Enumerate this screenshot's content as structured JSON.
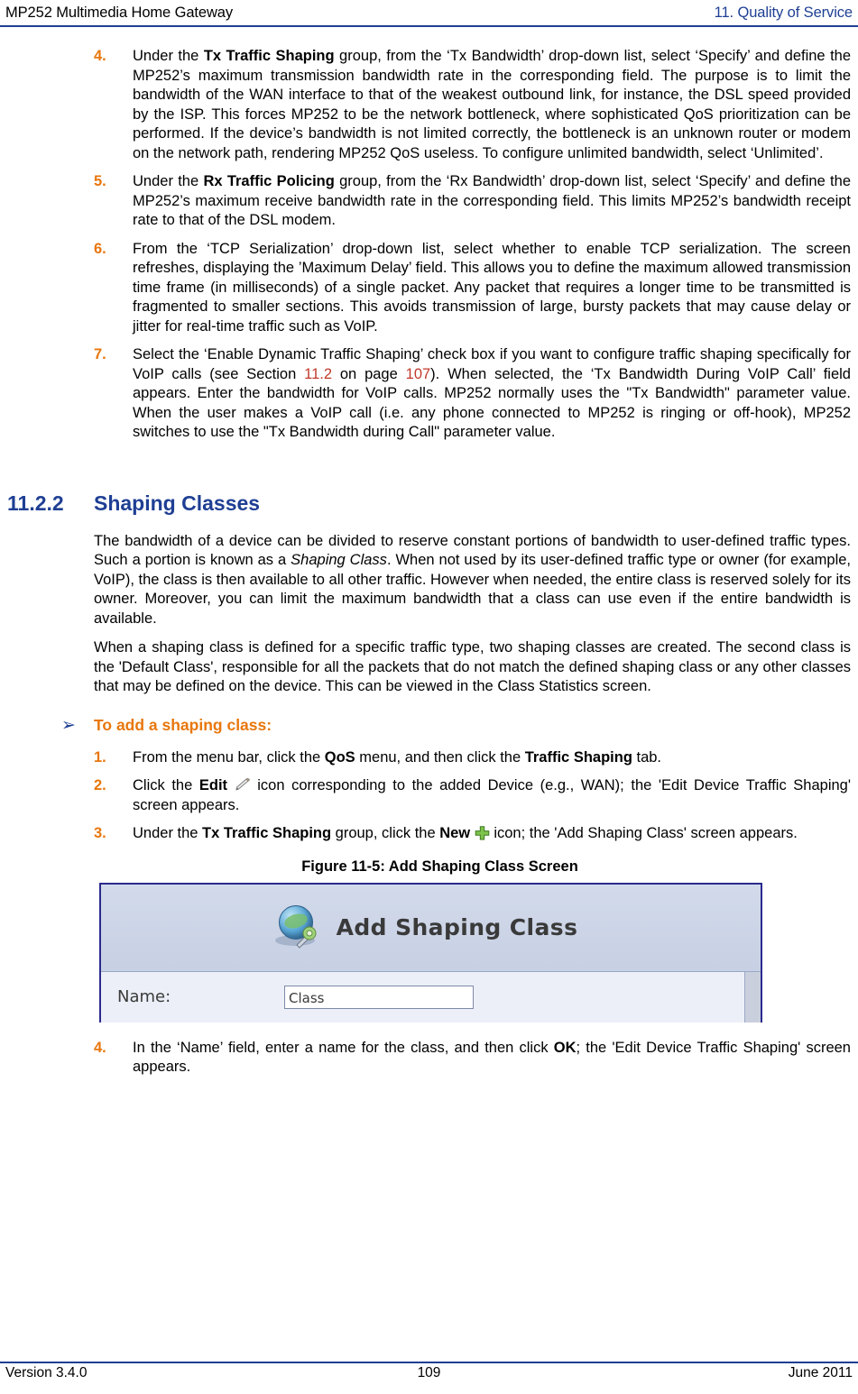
{
  "header": {
    "left": "MP252 Multimedia Home Gateway",
    "right": "11. Quality of Service"
  },
  "footer": {
    "left": "Version 3.4.0",
    "center": "109",
    "right": "June 2011"
  },
  "steps_top": [
    {
      "num": "4.",
      "html": "Under the <b>Tx&nbsp;Traffic&nbsp;Shaping</b> group, from the &lsquo;Tx Bandwidth&rsquo; drop-down list, select &lsquo;Specify&rsquo; and define the MP252&rsquo;s maximum transmission bandwidth rate in the corresponding field. The purpose is to limit the bandwidth of the WAN interface to that of the weakest outbound link, for instance, the DSL speed provided by the ISP. This forces MP252 to be the network bottleneck, where sophisticated QoS prioritization can be performed. If the device&rsquo;s bandwidth is not limited correctly, the bottleneck is an unknown router or modem on the network path, rendering MP252 QoS useless. To configure unlimited bandwidth, select &lsquo;Unlimited&rsquo;."
    },
    {
      "num": "5.",
      "html": "Under the <b>Rx&nbsp;Traffic&nbsp;Policing</b> group, from the &lsquo;Rx Bandwidth&rsquo; drop-down list, select &lsquo;Specify&rsquo; and define the MP252&rsquo;s maximum receive bandwidth rate in the corresponding field. This limits MP252&rsquo;s bandwidth receipt rate to that of the DSL modem."
    },
    {
      "num": "6.",
      "html": "From the &lsquo;TCP Serialization&rsquo; drop-down list, select whether to enable TCP serialization. The screen refreshes, displaying the &rsquo;Maximum Delay&rsquo; field. This allows you to define the maximum allowed transmission time frame (in milliseconds) of a single packet. Any packet that requires a longer time to be transmitted is fragmented to smaller sections. This avoids transmission of large, bursty packets that may cause delay or jitter for real-time traffic such as VoIP."
    },
    {
      "num": "7.",
      "html": "Select the &lsquo;Enable Dynamic Traffic Shaping&rsquo; check box if you want to configure traffic shaping specifically for VoIP calls (see Section <span class=\"lnk\">11.2</span> on page <span class=\"lnk\">107</span>). When selected, the &lsquo;Tx Bandwidth During VoIP Call&rsquo; field appears. Enter the bandwidth for VoIP calls. MP252 normally uses the &quot;Tx Bandwidth&quot; parameter value. When the user makes a VoIP call (i.e. any phone connected to MP252 is ringing or off-hook), MP252 switches to use the &quot;Tx Bandwidth during Call&quot; parameter value."
    }
  ],
  "section": {
    "number": "11.2.2",
    "title": "Shaping Classes"
  },
  "paragraphs": [
    "The bandwidth of a device can be divided to reserve constant portions of bandwidth to user-defined traffic types. Such a portion is known as a <i>Shaping Class</i>. When not used by its user-defined traffic type or owner (for example, VoIP), the class is then available to all other traffic. However when needed, the entire class is reserved solely for its owner. Moreover, you can limit the maximum bandwidth that a class can use even if the entire bandwidth is available.",
    "When a shaping class is defined for a specific traffic type, two shaping classes are created. The second class is the &#39;Default Class&#39;, responsible for all the packets that do not match the defined shaping class or any other classes that may be defined on the device. This can be viewed in the Class Statistics screen."
  ],
  "procedure": {
    "arrow": "➢",
    "title": "To add a shaping class:"
  },
  "steps_proc": [
    {
      "num": "1.",
      "html": "From the menu bar, click the <b>QoS</b> menu, and then click the <b>Traffic&nbsp;Shaping</b> tab."
    },
    {
      "num": "2.",
      "html": "Click the <b>Edit</b> <span class=\"icon-slot\" data-icon=\"pencil-icon\"></span> icon corresponding to the added Device (e.g., WAN); the &#39;Edit Device Traffic Shaping&#39; screen appears."
    },
    {
      "num": "3.",
      "html": "Under the <b>Tx&nbsp;Traffic&nbsp;Shaping</b> group, click the <b>New</b> <span class=\"icon-slot\" data-icon=\"plus-icon\"></span> icon; the &#39;Add Shaping Class&#39; screen appears."
    }
  ],
  "figure": {
    "caption": "Figure 11-5: Add Shaping Class Screen",
    "screen_title": "Add Shaping Class",
    "name_label": "Name:",
    "name_value": "Class"
  },
  "steps_bottom": [
    {
      "num": "4.",
      "html": "In the &lsquo;Name&rsquo; field, enter a name for the class, and then click <b>OK</b>; the &#39;Edit Device Traffic Shaping&#39; screen appears."
    }
  ],
  "colors": {
    "accent_blue": "#1f3f94",
    "step_orange": "#e8770d",
    "link_red": "#c0392b"
  }
}
